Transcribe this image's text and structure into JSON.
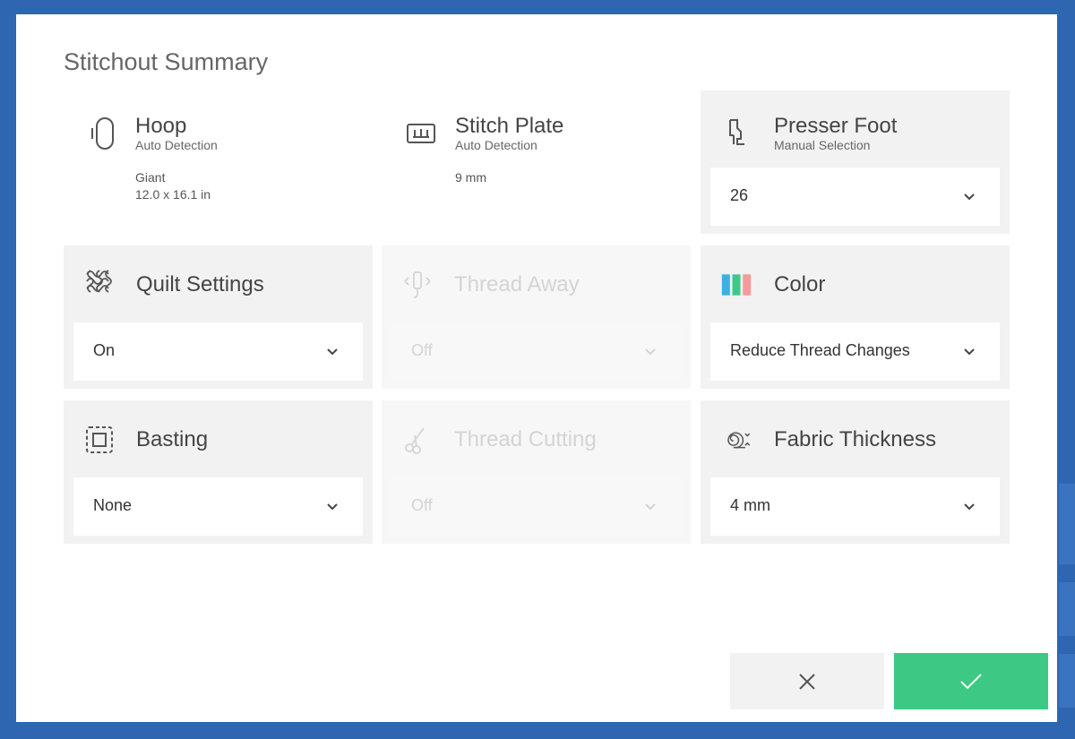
{
  "dialog": {
    "title": "Stitchout Summary"
  },
  "hoop": {
    "title": "Hoop",
    "subtitle": "Auto Detection",
    "line1": "Giant",
    "line2": "12.0 x 16.1 in",
    "icon": "hoop-icon"
  },
  "stitch_plate": {
    "title": "Stitch Plate",
    "subtitle": "Auto Detection",
    "line1": "9 mm",
    "icon": "stitch-plate-icon"
  },
  "presser_foot": {
    "title": "Presser Foot",
    "subtitle": "Manual Selection",
    "value": "26",
    "icon": "presser-foot-icon"
  },
  "quilt_settings": {
    "title": "Quilt Settings",
    "value": "On",
    "icon": "quilt-icon"
  },
  "thread_away": {
    "title": "Thread Away",
    "value": "Off",
    "icon": "thread-away-icon",
    "disabled": true
  },
  "color": {
    "title": "Color",
    "value": "Reduce Thread Changes",
    "icon": "color-bars-icon",
    "swatches": [
      "#3bb0e6",
      "#3ec98a",
      "#f59a9a"
    ]
  },
  "basting": {
    "title": "Basting",
    "value": "None",
    "icon": "basting-icon"
  },
  "thread_cutting": {
    "title": "Thread Cutting",
    "value": "Off",
    "icon": "scissors-icon",
    "disabled": true
  },
  "fabric_thickness": {
    "title": "Fabric Thickness",
    "value": "4 mm",
    "icon": "fabric-roll-icon"
  },
  "buttons": {
    "cancel": "close-icon",
    "confirm": "checkmark-icon"
  },
  "colors": {
    "accent_confirm": "#3dc983",
    "background": "#2f66b2",
    "panel": "#f2f2f2"
  }
}
